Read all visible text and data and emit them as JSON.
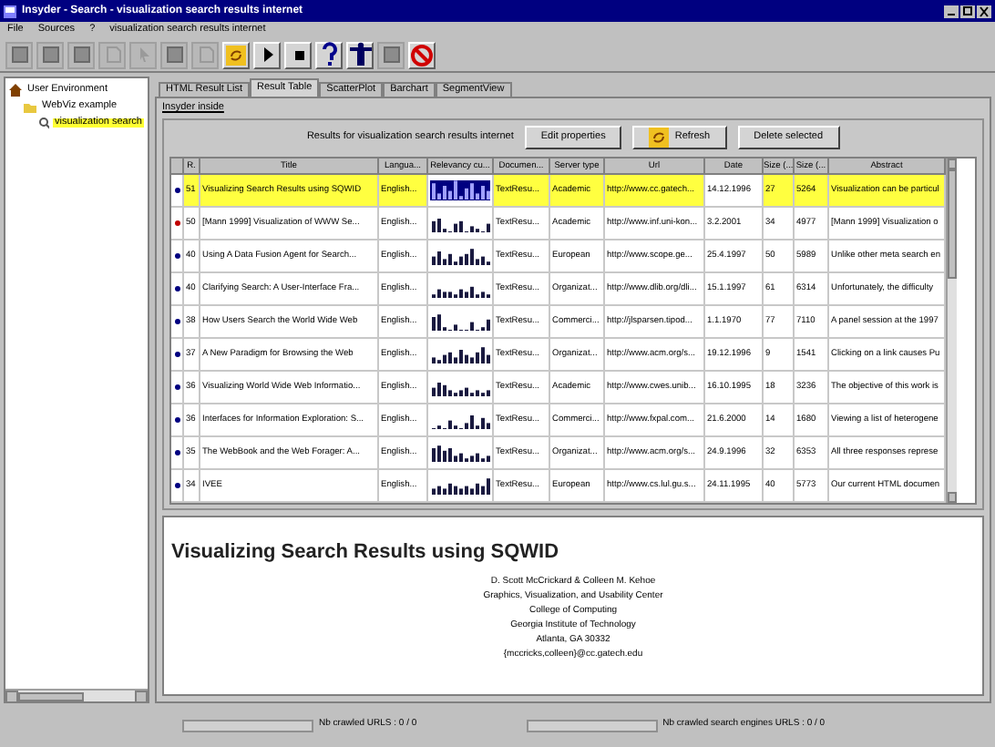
{
  "window": {
    "title": "Insyder - Search - visualization search results internet"
  },
  "menu": {
    "items": [
      "File",
      "Sources",
      "?"
    ],
    "query": "visualization search results internet"
  },
  "toolbar": [
    {
      "kind": "blank",
      "disabled": true
    },
    {
      "kind": "blank",
      "disabled": true
    },
    {
      "kind": "blank",
      "disabled": true
    },
    {
      "kind": "doc",
      "disabled": true
    },
    {
      "kind": "cursor",
      "disabled": true
    },
    {
      "kind": "blank",
      "disabled": true
    },
    {
      "kind": "doc",
      "disabled": true
    },
    {
      "kind": "refresh",
      "disabled": false
    },
    {
      "kind": "play",
      "disabled": false
    },
    {
      "kind": "stop",
      "disabled": false
    },
    {
      "kind": "help",
      "disabled": false
    },
    {
      "kind": "figure",
      "disabled": false
    },
    {
      "kind": "blank",
      "disabled": true
    },
    {
      "kind": "cancel",
      "disabled": false
    }
  ],
  "tree": [
    {
      "label": "User Environment",
      "kind": "home",
      "selected": false,
      "children": [
        {
          "label": "WebViz example",
          "kind": "folder",
          "selected": false,
          "children": [
            {
              "label": "visualization search",
              "kind": "search",
              "selected": true
            }
          ]
        }
      ]
    }
  ],
  "tabs": [
    {
      "label": "HTML Result List",
      "selected": false
    },
    {
      "label": "Result Table",
      "selected": true
    },
    {
      "label": "ScatterPlot",
      "selected": false
    },
    {
      "label": "Barchart",
      "selected": false
    },
    {
      "label": "SegmentView",
      "selected": false
    }
  ],
  "group_label": "Insyder inside",
  "results_label": "Results for visualization search results internet",
  "buttons": [
    {
      "label": "Edit properties",
      "kind": "plain"
    },
    {
      "label": "Refresh",
      "kind": "refresh"
    },
    {
      "label": "Delete selected",
      "kind": "plain"
    }
  ],
  "table": {
    "columns": [
      "R.",
      "Title",
      "Langua...",
      "Relevancy cu...",
      "Documen...",
      "Server type",
      "Url",
      "Date",
      "Size (...",
      "Size (...",
      "Abstract"
    ],
    "rows": [
      {
        "selected": true,
        "color": "#000080",
        "r": "51",
        "title": "Visualizing Search Results using SQWID",
        "lang": "English...",
        "doc": "TextResu...",
        "server": "Academic",
        "url": "http://www.cc.gatech...",
        "date": "14.12.1996",
        "size1": "27",
        "size2": "5264",
        "abstract": "Visualization can be particul"
      },
      {
        "selected": false,
        "color": "#c00000",
        "r": "50",
        "title": "[Mann 1999] Visualization of WWW Se...",
        "lang": "English...",
        "doc": "TextResu...",
        "server": "Academic",
        "url": "http://www.inf.uni-kon...",
        "date": "3.2.2001",
        "size1": "34",
        "size2": "4977",
        "abstract": "[Mann 1999] Visualization o"
      },
      {
        "selected": false,
        "color": "#000080",
        "r": "40",
        "title": "Using A Data Fusion Agent for Search...",
        "lang": "English...",
        "doc": "TextResu...",
        "server": "European",
        "url": "http://www.scope.ge...",
        "date": "25.4.1997",
        "size1": "50",
        "size2": "5989",
        "abstract": "Unlike other meta search en"
      },
      {
        "selected": false,
        "color": "#000080",
        "r": "40",
        "title": "Clarifying Search: A User-Interface Fra...",
        "lang": "English...",
        "doc": "TextResu...",
        "server": "Organizat...",
        "url": "http://www.dlib.org/dli...",
        "date": "15.1.1997",
        "size1": "61",
        "size2": "6314",
        "abstract": "Unfortunately, the difficulty"
      },
      {
        "selected": false,
        "color": "#000080",
        "r": "38",
        "title": "How Users Search the World Wide Web",
        "lang": "English...",
        "doc": "TextResu...",
        "server": "Commerci...",
        "url": "http://jlsparsen.tipod...",
        "date": "1.1.1970",
        "size1": "77",
        "size2": "7110",
        "abstract": "A panel session at the 1997"
      },
      {
        "selected": false,
        "color": "#000080",
        "r": "37",
        "title": "A New Paradigm for Browsing the Web",
        "lang": "English...",
        "doc": "TextResu...",
        "server": "Organizat...",
        "url": "http://www.acm.org/s...",
        "date": "19.12.1996",
        "size1": "9",
        "size2": "1541",
        "abstract": "Clicking on a link causes Pu"
      },
      {
        "selected": false,
        "color": "#000080",
        "r": "36",
        "title": "Visualizing World Wide Web Informatio...",
        "lang": "English...",
        "doc": "TextResu...",
        "server": "Academic",
        "url": "http://www.cwes.unib...",
        "date": "16.10.1995",
        "size1": "18",
        "size2": "3236",
        "abstract": "The objective of this work is"
      },
      {
        "selected": false,
        "color": "#000080",
        "r": "36",
        "title": "Interfaces for Information Exploration: S...",
        "lang": "English...",
        "doc": "TextResu...",
        "server": "Commerci...",
        "url": "http://www.fxpal.com...",
        "date": "21.6.2000",
        "size1": "14",
        "size2": "1680",
        "abstract": "Viewing a list of heterogene"
      },
      {
        "selected": false,
        "color": "#000080",
        "r": "35",
        "title": "The WebBook and the Web Forager: A...",
        "lang": "English...",
        "doc": "TextResu...",
        "server": "Organizat...",
        "url": "http://www.acm.org/s...",
        "date": "24.9.1996",
        "size1": "32",
        "size2": "6353",
        "abstract": "All three responses represe"
      },
      {
        "selected": false,
        "color": "#000080",
        "r": "34",
        "title": "IVEE",
        "lang": "English...",
        "doc": "TextResu...",
        "server": "European",
        "url": "http://www.cs.lul.gu.s...",
        "date": "24.11.1995",
        "size1": "40",
        "size2": "5773",
        "abstract": "Our current HTML documen"
      }
    ]
  },
  "preview": {
    "heading": "Visualizing Search Results using SQWID",
    "lines": [
      "D. Scott McCrickard & Colleen M. Kehoe",
      "Graphics, Visualization, and Usability Center",
      "College of Computing",
      "Georgia Institute of Technology",
      "Atlanta, GA 30332",
      "{mccricks,colleen}@cc.gatech.edu"
    ]
  },
  "status_bar": [
    {
      "label": "Nb crawled URLS : 0 / 0"
    },
    {
      "label": "Nb crawled search engines URLS : 0 / 0"
    }
  ]
}
